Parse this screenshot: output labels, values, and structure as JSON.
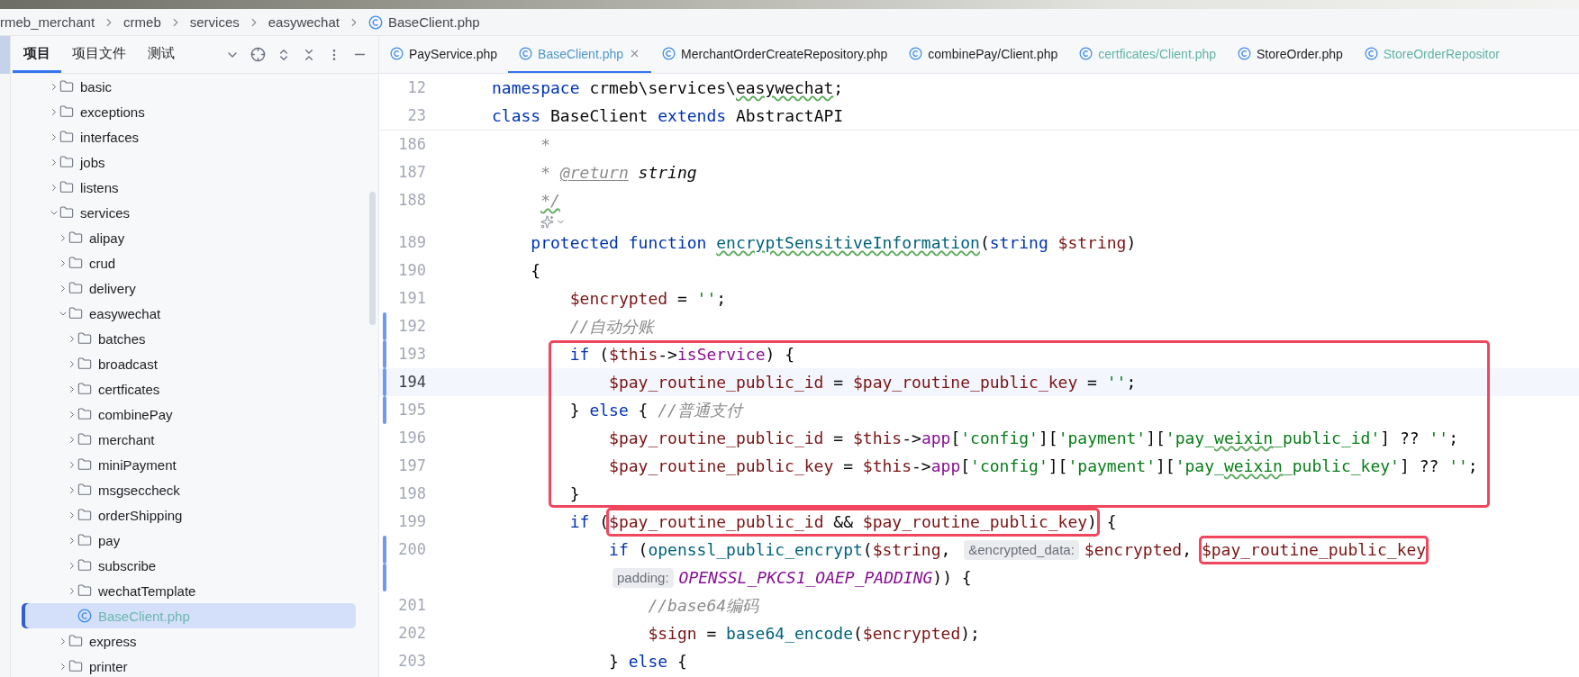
{
  "breadcrumbs": [
    {
      "text": "rmeb_merchant",
      "kind": "dir"
    },
    {
      "text": "crmeb",
      "kind": "dir"
    },
    {
      "text": "services",
      "kind": "dir"
    },
    {
      "text": "easywechat",
      "kind": "dir"
    },
    {
      "text": "BaseClient.php",
      "kind": "class"
    }
  ],
  "project_panel": {
    "tabs": [
      {
        "label": "项目",
        "selected": true
      },
      {
        "label": "项目文件",
        "selected": false
      },
      {
        "label": "测试",
        "selected": false
      }
    ],
    "tree": [
      {
        "name": "basic",
        "kind": "folder",
        "expanded": false,
        "selected": false
      },
      {
        "name": "exceptions",
        "kind": "folder",
        "expanded": false,
        "selected": false
      },
      {
        "name": "interfaces",
        "kind": "folder",
        "expanded": false,
        "selected": false
      },
      {
        "name": "jobs",
        "kind": "folder",
        "expanded": false,
        "selected": false
      },
      {
        "name": "listens",
        "kind": "folder",
        "expanded": false,
        "selected": false
      },
      {
        "name": "services",
        "kind": "folder",
        "expanded": true,
        "selected": false,
        "children": [
          {
            "name": "alipay",
            "kind": "folder",
            "expanded": false,
            "selected": false
          },
          {
            "name": "crud",
            "kind": "folder",
            "expanded": false,
            "selected": false
          },
          {
            "name": "delivery",
            "kind": "folder",
            "expanded": false,
            "selected": false
          },
          {
            "name": "easywechat",
            "kind": "folder",
            "expanded": true,
            "selected": false,
            "children": [
              {
                "name": "batches",
                "kind": "folder",
                "expanded": false,
                "selected": false
              },
              {
                "name": "broadcast",
                "kind": "folder",
                "expanded": false,
                "selected": false
              },
              {
                "name": "certficates",
                "kind": "folder",
                "expanded": false,
                "selected": false
              },
              {
                "name": "combinePay",
                "kind": "folder",
                "expanded": false,
                "selected": false
              },
              {
                "name": "merchant",
                "kind": "folder",
                "expanded": false,
                "selected": false
              },
              {
                "name": "miniPayment",
                "kind": "folder",
                "expanded": false,
                "selected": false
              },
              {
                "name": "msgseccheck",
                "kind": "folder",
                "expanded": false,
                "selected": false
              },
              {
                "name": "orderShipping",
                "kind": "folder",
                "expanded": false,
                "selected": false
              },
              {
                "name": "pay",
                "kind": "folder",
                "expanded": false,
                "selected": false
              },
              {
                "name": "subscribe",
                "kind": "folder",
                "expanded": false,
                "selected": false
              },
              {
                "name": "wechatTemplate",
                "kind": "folder",
                "expanded": false,
                "selected": false
              },
              {
                "name": "BaseClient.php",
                "kind": "file",
                "selected": true,
                "color": "#6cb6ad"
              }
            ]
          },
          {
            "name": "express",
            "kind": "folder",
            "expanded": false,
            "selected": false
          },
          {
            "name": "printer",
            "kind": "folder",
            "expanded": false,
            "selected": false
          }
        ]
      }
    ]
  },
  "editor_tabs": [
    {
      "label": "PayService.php",
      "selected": false,
      "color": "#1e1f22"
    },
    {
      "label": "BaseClient.php",
      "selected": true,
      "color": "#4f97c9"
    },
    {
      "label": "MerchantOrderCreateRepository.php",
      "selected": false,
      "color": "#1e1f22"
    },
    {
      "label": "combinePay/Client.php",
      "selected": false,
      "color": "#1e1f22"
    },
    {
      "label": "certficates/Client.php",
      "selected": false,
      "color": "#62b3a7"
    },
    {
      "label": "StoreOrder.php",
      "selected": false,
      "color": "#1e1f22"
    },
    {
      "label": "StoreOrderRepositor",
      "selected": false,
      "color": "#62b3a7"
    }
  ],
  "sticky_lines": [
    {
      "number": "12",
      "tokens": [
        {
          "kind": "kw",
          "text": "namespace "
        },
        {
          "kind": "txt",
          "text": "crmeb\\services\\"
        },
        {
          "kind": "txt",
          "text": "easywechat",
          "typo": true
        },
        {
          "kind": "txt",
          "text": ";"
        }
      ]
    },
    {
      "number": "23",
      "tokens": [
        {
          "kind": "kw",
          "text": "class "
        },
        {
          "kind": "txt",
          "text": "BaseClient "
        },
        {
          "kind": "kw",
          "text": "extends "
        },
        {
          "kind": "txt",
          "text": "AbstractAPI"
        }
      ]
    }
  ],
  "lines": [
    {
      "kind": "code",
      "number": "186",
      "changed": false,
      "current": false,
      "in_box": false,
      "tokens": [
        {
          "kind": "doc",
          "text": "     *"
        }
      ]
    },
    {
      "kind": "code",
      "number": "187",
      "changed": false,
      "current": false,
      "in_box": false,
      "tokens": [
        {
          "kind": "doc",
          "text": "     * "
        },
        {
          "kind": "doctag",
          "text": "@return"
        },
        {
          "kind": "doctype",
          "text": " string"
        }
      ]
    },
    {
      "kind": "code",
      "number": "188",
      "changed": false,
      "current": false,
      "in_box": false,
      "tokens": [
        {
          "kind": "doc",
          "text": "     */",
          "typo": true
        }
      ]
    },
    {
      "kind": "icon_row"
    },
    {
      "kind": "code",
      "number": "189",
      "changed": false,
      "current": false,
      "in_box": false,
      "tokens": [
        {
          "kind": "kw",
          "text": "    protected function "
        },
        {
          "kind": "fndecl",
          "text": "encryptSensitiveInformation",
          "typo": true
        },
        {
          "kind": "txt",
          "text": "("
        },
        {
          "kind": "kw",
          "text": "string "
        },
        {
          "kind": "var",
          "text": "$string"
        },
        {
          "kind": "txt",
          "text": ")"
        }
      ]
    },
    {
      "kind": "code",
      "number": "190",
      "changed": false,
      "current": false,
      "in_box": false,
      "tokens": [
        {
          "kind": "txt",
          "text": "    {"
        }
      ]
    },
    {
      "kind": "code",
      "number": "191",
      "changed": false,
      "current": false,
      "in_box": false,
      "tokens": [
        {
          "kind": "var",
          "text": "        $encrypted"
        },
        {
          "kind": "txt",
          "text": " = "
        },
        {
          "kind": "str",
          "text": "''"
        },
        {
          "kind": "txt",
          "text": ";"
        }
      ]
    },
    {
      "kind": "code",
      "number": "192",
      "changed": true,
      "current": false,
      "in_box": false,
      "tokens": [
        {
          "kind": "cmt",
          "text": "        //自动分账"
        }
      ]
    },
    {
      "kind": "code",
      "number": "193",
      "changed": true,
      "current": false,
      "in_box": true,
      "tokens": [
        {
          "kind": "kw",
          "text": "        if"
        },
        {
          "kind": "txt",
          "text": " ("
        },
        {
          "kind": "var",
          "text": "$this"
        },
        {
          "kind": "txt",
          "text": "->"
        },
        {
          "kind": "member",
          "text": "isService"
        },
        {
          "kind": "txt",
          "text": ") {"
        }
      ]
    },
    {
      "kind": "code",
      "number": "194",
      "changed": true,
      "current": true,
      "in_box": true,
      "tokens": [
        {
          "kind": "var",
          "text": "            $pay_routine_public_id"
        },
        {
          "kind": "txt",
          "text": " = "
        },
        {
          "kind": "var",
          "text": "$pay_routine_public_key"
        },
        {
          "kind": "txt",
          "text": " = "
        },
        {
          "kind": "str",
          "text": "''"
        },
        {
          "kind": "txt",
          "text": ";"
        }
      ]
    },
    {
      "kind": "code",
      "number": "195",
      "changed": true,
      "current": false,
      "in_box": true,
      "tokens": [
        {
          "kind": "txt",
          "text": "        } "
        },
        {
          "kind": "kw",
          "text": "else"
        },
        {
          "kind": "txt",
          "text": " { "
        },
        {
          "kind": "cmt",
          "text": "//普通支付"
        }
      ]
    },
    {
      "kind": "code",
      "number": "196",
      "changed": false,
      "current": false,
      "in_box": true,
      "tokens": [
        {
          "kind": "var",
          "text": "            $pay_routine_public_id"
        },
        {
          "kind": "txt",
          "text": " = "
        },
        {
          "kind": "var",
          "text": "$this"
        },
        {
          "kind": "txt",
          "text": "->"
        },
        {
          "kind": "member",
          "text": "app"
        },
        {
          "kind": "txt",
          "text": "["
        },
        {
          "kind": "str",
          "text": "'config'"
        },
        {
          "kind": "txt",
          "text": "]["
        },
        {
          "kind": "str",
          "text": "'payment'"
        },
        {
          "kind": "txt",
          "text": "]["
        },
        {
          "kind": "str",
          "text": "'pay_"
        },
        {
          "kind": "str",
          "text": "weixin",
          "typo": true
        },
        {
          "kind": "str",
          "text": "_public_id'"
        },
        {
          "kind": "txt",
          "text": "] ?? "
        },
        {
          "kind": "str",
          "text": "''"
        },
        {
          "kind": "txt",
          "text": ";"
        }
      ]
    },
    {
      "kind": "code",
      "number": "197",
      "changed": false,
      "current": false,
      "in_box": true,
      "tokens": [
        {
          "kind": "var",
          "text": "            $pay_routine_public_key"
        },
        {
          "kind": "txt",
          "text": " = "
        },
        {
          "kind": "var",
          "text": "$this"
        },
        {
          "kind": "txt",
          "text": "->"
        },
        {
          "kind": "member",
          "text": "app"
        },
        {
          "kind": "txt",
          "text": "["
        },
        {
          "kind": "str",
          "text": "'config'"
        },
        {
          "kind": "txt",
          "text": "]["
        },
        {
          "kind": "str",
          "text": "'payment'"
        },
        {
          "kind": "txt",
          "text": "]["
        },
        {
          "kind": "str",
          "text": "'pay_"
        },
        {
          "kind": "str",
          "text": "weixin",
          "typo": true
        },
        {
          "kind": "str",
          "text": "_public_key'"
        },
        {
          "kind": "txt",
          "text": "] ?? "
        },
        {
          "kind": "str",
          "text": "''"
        },
        {
          "kind": "txt",
          "text": ";"
        }
      ]
    },
    {
      "kind": "code",
      "number": "198",
      "changed": false,
      "current": false,
      "in_box": true,
      "tokens": [
        {
          "kind": "txt",
          "text": "        }"
        }
      ]
    },
    {
      "kind": "code",
      "number": "199",
      "changed": false,
      "current": false,
      "in_box": false,
      "tokens": [
        {
          "kind": "kw",
          "text": "        if"
        },
        {
          "kind": "txt",
          "text": " ("
        },
        {
          "kind": "group",
          "boxed": true,
          "tokens": [
            {
              "kind": "var",
              "text": "$pay_routine_public_id"
            },
            {
              "kind": "txt",
              "text": " && "
            },
            {
              "kind": "var",
              "text": "$pay_routine_public_key"
            },
            {
              "kind": "txt",
              "text": ")"
            }
          ]
        },
        {
          "kind": "txt",
          "text": " {"
        }
      ]
    },
    {
      "kind": "code",
      "number": "200",
      "changed": true,
      "current": false,
      "in_box": false,
      "tokens": [
        {
          "kind": "kw",
          "text": "            if"
        },
        {
          "kind": "txt",
          "text": " ("
        },
        {
          "kind": "fn",
          "text": "openssl_public_encrypt"
        },
        {
          "kind": "txt",
          "text": "("
        },
        {
          "kind": "var",
          "text": "$string"
        },
        {
          "kind": "txt",
          "text": ", "
        },
        {
          "kind": "hint",
          "text": "&encrypted_data:"
        },
        {
          "kind": "var",
          "text": "$encrypted"
        },
        {
          "kind": "txt",
          "text": ", "
        },
        {
          "kind": "group",
          "boxed": true,
          "tokens": [
            {
              "kind": "var",
              "text": "$pay_routine_public_key"
            }
          ]
        }
      ]
    },
    {
      "kind": "code",
      "changed": true,
      "current": false,
      "in_box": false,
      "tokens": [
        {
          "kind": "hint",
          "text": "padding:"
        },
        {
          "kind": "const",
          "text": "OPENSSL_PKCS1_OAEP_PADDING"
        },
        {
          "kind": "txt",
          "text": ")) {"
        }
      ]
    },
    {
      "kind": "code",
      "number": "201",
      "changed": false,
      "current": false,
      "in_box": false,
      "tokens": [
        {
          "kind": "cmt",
          "text": "                //base64编码"
        }
      ]
    },
    {
      "kind": "code",
      "number": "202",
      "changed": false,
      "current": false,
      "in_box": false,
      "tokens": [
        {
          "kind": "var",
          "text": "                $sign"
        },
        {
          "kind": "txt",
          "text": " = "
        },
        {
          "kind": "fn",
          "text": "base64_encode"
        },
        {
          "kind": "txt",
          "text": "("
        },
        {
          "kind": "var",
          "text": "$encrypted"
        },
        {
          "kind": "txt",
          "text": ");"
        }
      ]
    },
    {
      "kind": "code",
      "number": "203",
      "changed": false,
      "current": false,
      "in_box": false,
      "tokens": [
        {
          "kind": "txt",
          "text": "            } "
        },
        {
          "kind": "kw",
          "text": "else"
        },
        {
          "kind": "txt",
          "text": " {"
        }
      ]
    }
  ]
}
